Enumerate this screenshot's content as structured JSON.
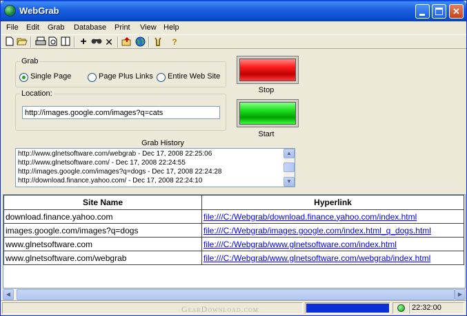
{
  "window": {
    "title": "WebGrab"
  },
  "menu": [
    "File",
    "Edit",
    "Grab",
    "Database",
    "Print",
    "View",
    "Help"
  ],
  "toolbar": {
    "icons": [
      "new-icon",
      "open-icon",
      "print-icon",
      "print-preview-icon",
      "page-setup-icon",
      "add-icon",
      "find-icon",
      "delete-icon",
      "export-icon",
      "globe-icon",
      "settings-icon",
      "help-icon"
    ]
  },
  "grab": {
    "group_label": "Grab",
    "options": [
      "Single Page",
      "Page Plus Links",
      "Entire Web Site"
    ],
    "selected": "Single Page"
  },
  "location": {
    "group_label": "Location:",
    "value": "http://images.google.com/images?q=cats"
  },
  "buttons": {
    "stop_label": "Stop",
    "start_label": "Start"
  },
  "history": {
    "title": "Grab History",
    "entries": [
      "http://www.glnetsoftware.com/webgrab - Dec 17, 2008 22:25:06",
      "http://www.glnetsoftware.com/ - Dec 17, 2008 22:24:55",
      "http://images.google.com/images?q=dogs - Dec 17, 2008 22:24:28",
      "http://download.finance.yahoo.com/ - Dec 17, 2008 22:24:10"
    ]
  },
  "table": {
    "headers": [
      "Site Name",
      "Hyperlink"
    ],
    "rows": [
      [
        "download.finance.yahoo.com",
        "file:///C:/Webgrab/download.finance.yahoo.com/index.html"
      ],
      [
        "images.google.com/images?q=dogs",
        "file:///C:/Webgrab/images.google.com/index.html_q_dogs.html"
      ],
      [
        "www.glnetsoftware.com",
        "file:///C:/Webgrab/www.glnetsoftware.com/index.html"
      ],
      [
        "www.glnetsoftware.com/webgrab",
        "file:///C:/Webgrab/www.glnetsoftware.com/webgrab/index.html"
      ]
    ]
  },
  "status": {
    "progress_percent": 100,
    "progress_color": "#0b2ed6",
    "indicator_color": "#0a9a0a",
    "clock": "22:32:00"
  },
  "watermark": "GearDownload.com"
}
